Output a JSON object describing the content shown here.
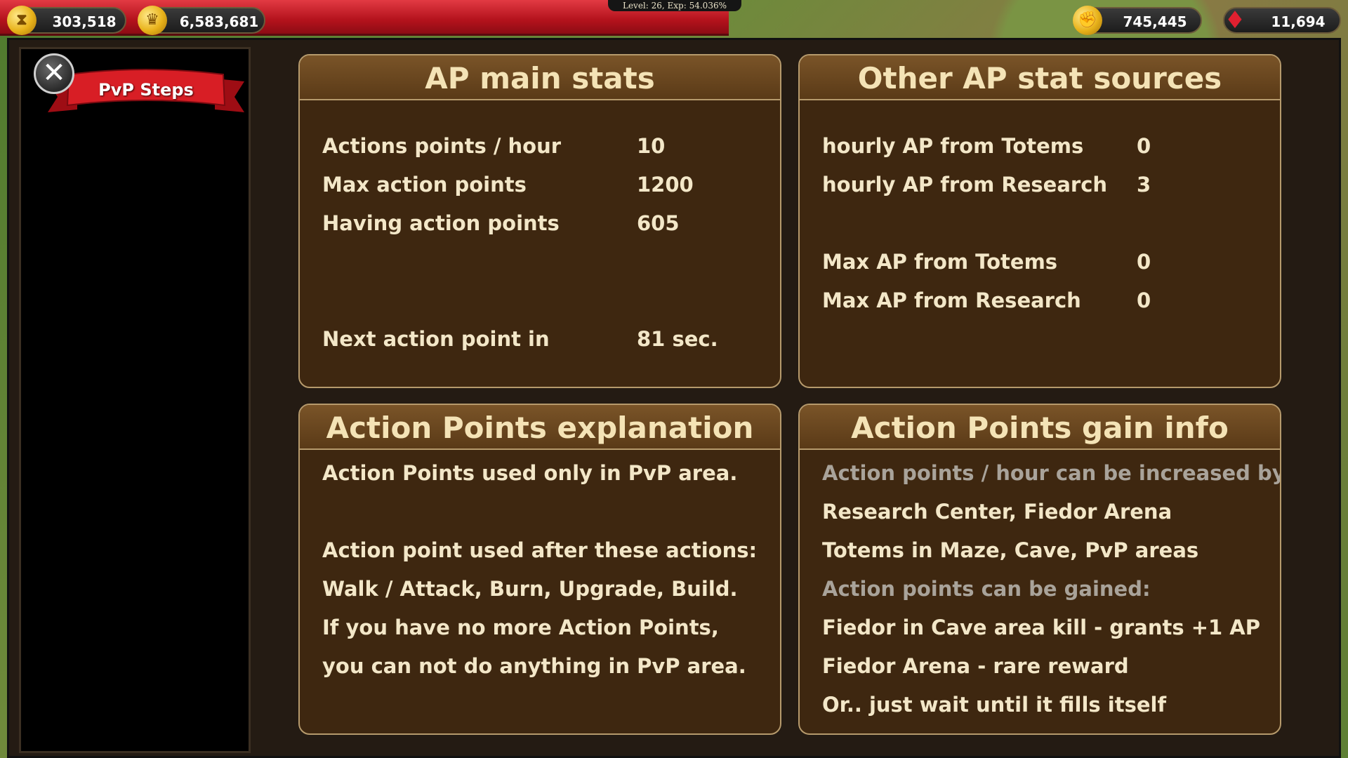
{
  "hud": {
    "xp_label": "Level: 26, Exp: 54.036%",
    "resource_1": "303,518",
    "resource_2": "6,583,681",
    "resource_3": "745,445",
    "resource_4": "11,694"
  },
  "sidebar": {
    "close_label": "✕",
    "title": "PvP Steps"
  },
  "panels": {
    "main_stats": {
      "title": "AP main stats",
      "rows": [
        {
          "label": "Actions points / hour",
          "value": "10"
        },
        {
          "label": "Max action points",
          "value": "1200"
        },
        {
          "label": "Having action points",
          "value": "605"
        },
        {
          "label": "Next action point in",
          "value": "81 sec."
        }
      ]
    },
    "other_sources": {
      "title": "Other AP stat sources",
      "rows": [
        {
          "label": "hourly AP from Totems",
          "value": "0"
        },
        {
          "label": "hourly AP from Research",
          "value": "3"
        },
        {
          "label": "Max AP from Totems",
          "value": "0"
        },
        {
          "label": "Max AP from Research",
          "value": "0"
        }
      ]
    },
    "explanation": {
      "title": "Action Points explanation",
      "lines": [
        "Action Points used only in PvP area.",
        "Action point used after these actions:",
        "Walk / Attack, Burn, Upgrade, Build.",
        "If you have no more Action Points,",
        "you can not do anything in PvP area."
      ]
    },
    "gain_info": {
      "title": "Action Points gain info",
      "lines": [
        "Action points / hour can be increased by:",
        "Research Center, Fiedor Arena",
        "Totems in Maze, Cave, PvP areas",
        "Action points can be gained:",
        "Fiedor in Cave area kill - grants +1 AP",
        "Fiedor Arena - rare reward",
        "Or.. just wait until it fills itself"
      ]
    }
  }
}
